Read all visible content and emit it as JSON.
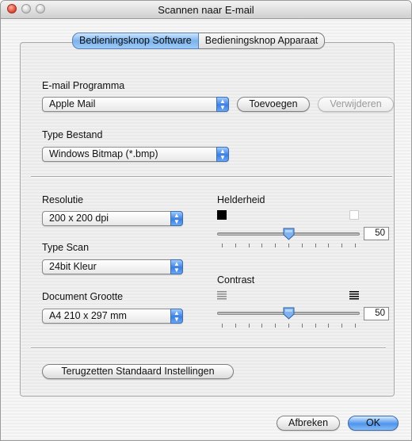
{
  "window": {
    "title": "Scannen naar E-mail"
  },
  "tabs": [
    {
      "label": "Bedieningsknop Software",
      "active": true
    },
    {
      "label": "Bedieningsknop Apparaat",
      "active": false
    }
  ],
  "email": {
    "label": "E-mail Programma",
    "selected": "Apple Mail",
    "add_button": "Toevoegen",
    "remove_button": "Verwijderen"
  },
  "file_type": {
    "label": "Type Bestand",
    "selected": "Windows Bitmap (*.bmp)"
  },
  "resolution": {
    "label": "Resolutie",
    "selected": "200 x 200 dpi"
  },
  "scan_type": {
    "label": "Type Scan",
    "selected": "24bit Kleur"
  },
  "doc_size": {
    "label": "Document Grootte",
    "selected": "A4 210 x 297 mm"
  },
  "brightness": {
    "label": "Helderheid",
    "value": "50",
    "fraction": 0.5
  },
  "contrast": {
    "label": "Contrast",
    "value": "50",
    "fraction": 0.5
  },
  "reset_button": "Terugzetten Standaard Instellingen",
  "cancel_button": "Afbreken",
  "ok_button": "OK",
  "colors": {
    "accent": "#4f94ec",
    "close": "#d9432f"
  },
  "icons": [
    "close-light-icon",
    "minimize-light-icon",
    "zoom-light-icon",
    "popup-arrows-icon",
    "slider-thumb-icon",
    "black-swatch-icon",
    "white-swatch-icon",
    "low-contrast-icon",
    "high-contrast-icon"
  ]
}
